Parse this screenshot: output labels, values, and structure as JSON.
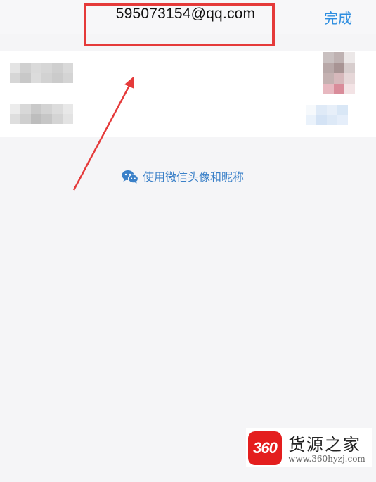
{
  "nav": {
    "title": "595073154@qq.com",
    "done_label": "完成"
  },
  "wechat_link": {
    "label": "使用微信头像和昵称",
    "icon": "wechat-icon"
  },
  "watermark": {
    "logo_text": "360",
    "name": "货源之家",
    "url": "www.360hyzj.com"
  },
  "colors": {
    "accent_blue": "#2e8ee0",
    "annotation_red": "#e53a3a",
    "background": "#f5f5f7",
    "card": "#ffffff"
  }
}
